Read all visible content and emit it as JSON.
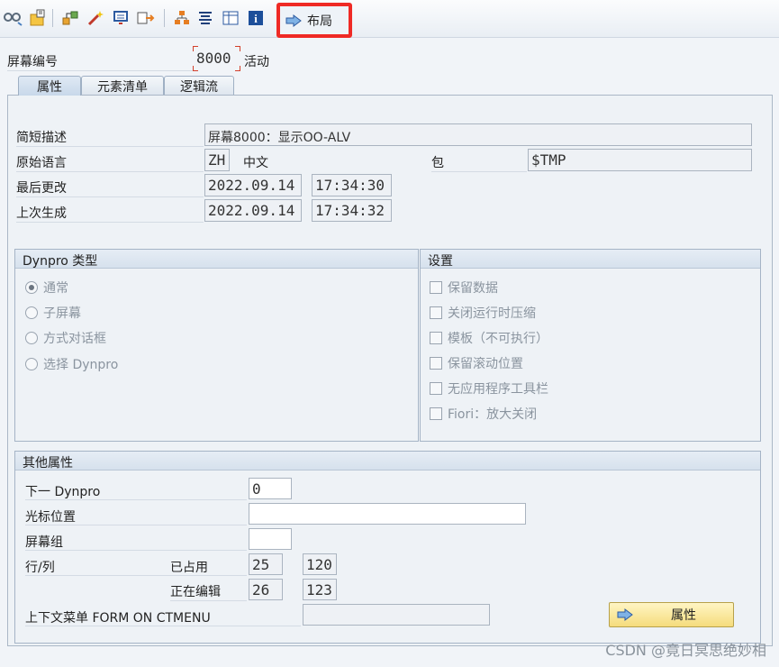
{
  "toolbar": {
    "icons": [
      "other-object-icon",
      "display-change-icon",
      "hierarchy-icon",
      "magic-wand-icon",
      "screen-test-icon",
      "navigate-icon",
      "element-tree-icon",
      "align-icon",
      "element-list-icon",
      "info-icon"
    ],
    "layout_label": "布局"
  },
  "header": {
    "screen_number_label": "屏幕编号",
    "screen_number_value": "8000",
    "status": "活动"
  },
  "tabs": [
    {
      "label": "属性",
      "active": true
    },
    {
      "label": "元素清单",
      "active": false
    },
    {
      "label": "逻辑流",
      "active": false
    }
  ],
  "attributes": {
    "short_desc_label": "简短描述",
    "short_desc_value": "屏幕8000：显示OO-ALV",
    "orig_lang_label": "原始语言",
    "orig_lang_code": "ZH",
    "orig_lang_name": "中文",
    "package_label": "包",
    "package_value": "$TMP",
    "last_changed_label": "最后更改",
    "last_changed_date": "2022.09.14",
    "last_changed_time": "17:34:30",
    "last_generated_label": "上次生成",
    "last_generated_date": "2022.09.14",
    "last_generated_time": "17:34:32"
  },
  "dynpro_type": {
    "title": "Dynpro 类型",
    "options": [
      {
        "label": "通常",
        "selected": true
      },
      {
        "label": "子屏幕",
        "selected": false
      },
      {
        "label": "方式对话框",
        "selected": false
      },
      {
        "label": "选择 Dynpro",
        "selected": false
      }
    ]
  },
  "settings": {
    "title": "设置",
    "options": [
      {
        "label": "保留数据",
        "checked": false
      },
      {
        "label": "关闭运行时压缩",
        "checked": false
      },
      {
        "label": "模板（不可执行）",
        "checked": false
      },
      {
        "label": "保留滚动位置",
        "checked": false
      },
      {
        "label": "无应用程序工具栏",
        "checked": false
      },
      {
        "label": "Fiori：放大关闭",
        "checked": false
      }
    ]
  },
  "other_attributes": {
    "title": "其他属性",
    "next_dynpro_label": "下一 Dynpro",
    "next_dynpro_value": "0",
    "cursor_pos_label": "光标位置",
    "cursor_pos_value": "",
    "screen_group_label": "屏幕组",
    "screen_group_value": "",
    "row_col_label": "行/列",
    "occupied_label": "已占用",
    "occupied_row": "25",
    "occupied_col": "120",
    "editing_label": "正在编辑",
    "editing_row": "26",
    "editing_col": "123",
    "context_menu_label": "上下文菜单 FORM ON CTMENU",
    "context_menu_value": "",
    "attributes_button": "属性"
  },
  "watermark": "CSDN @竟日冥思绝妙相",
  "colors": {
    "highlight": "#ef2a25",
    "button_yellow": "#f5dc7c"
  }
}
